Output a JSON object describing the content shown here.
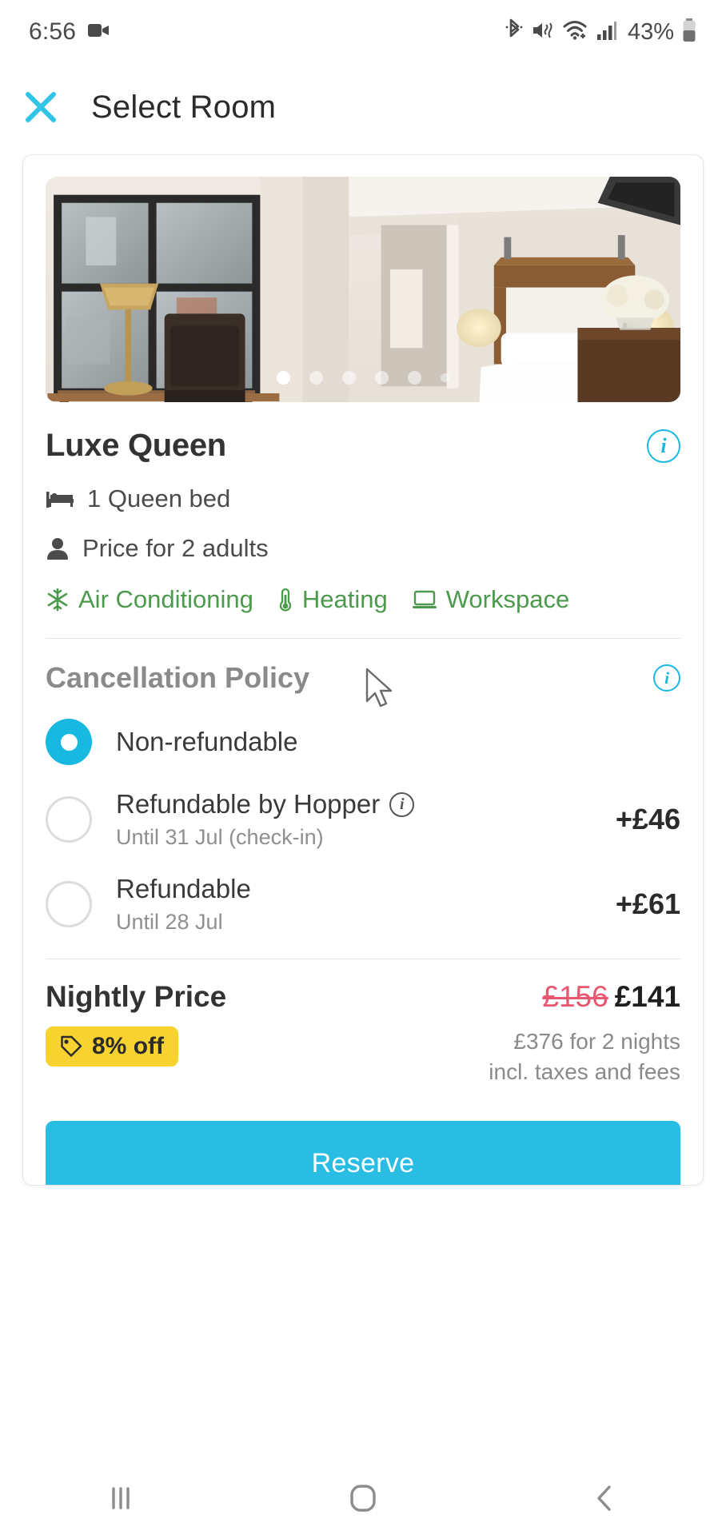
{
  "status_bar": {
    "time": "6:56",
    "battery_percent": "43%",
    "icons": [
      "video-camera-icon",
      "bluetooth-icon",
      "mute-icon",
      "wifi-icon",
      "signal-icon",
      "battery-icon"
    ]
  },
  "header": {
    "title": "Select Room",
    "close_icon": "close-icon"
  },
  "room": {
    "name": "Luxe Queen",
    "info_icon": "info-icon",
    "carousel": {
      "total_dots": 6,
      "active_index": 0
    },
    "bed": "1 Queen bed",
    "occupancy": "Price for 2 adults",
    "amenities": [
      {
        "label": "Air Conditioning",
        "icon": "snowflake-icon"
      },
      {
        "label": "Heating",
        "icon": "thermometer-icon"
      },
      {
        "label": "Workspace",
        "icon": "workspace-icon"
      }
    ]
  },
  "cancellation": {
    "title": "Cancellation Policy",
    "info_icon": "info-icon",
    "options": [
      {
        "label": "Non-refundable",
        "sub": "",
        "price": "",
        "selected": true,
        "has_info": false
      },
      {
        "label": "Refundable by Hopper",
        "sub": "Until 31 Jul (check-in)",
        "price": "+£46",
        "selected": false,
        "has_info": true
      },
      {
        "label": "Refundable",
        "sub": "Until 28 Jul",
        "price": "+£61",
        "selected": false,
        "has_info": false
      }
    ]
  },
  "pricing": {
    "label": "Nightly Price",
    "old_price": "£156",
    "new_price": "£141",
    "discount_badge": "8% off",
    "discount_icon": "tag-icon",
    "total_line1": "£376 for 2 nights",
    "total_line2": "incl. taxes and fees"
  },
  "cta": {
    "reserve_label": "Reserve"
  },
  "nav_bar": {
    "recents_icon": "recents-icon",
    "home_icon": "home-icon",
    "back_icon": "back-icon"
  },
  "colors": {
    "accent": "#18b9e0",
    "reserve": "#29bde4",
    "amenity_green": "#4c9a4c",
    "badge_yellow": "#f8d330",
    "strike_red": "#e8566f"
  }
}
